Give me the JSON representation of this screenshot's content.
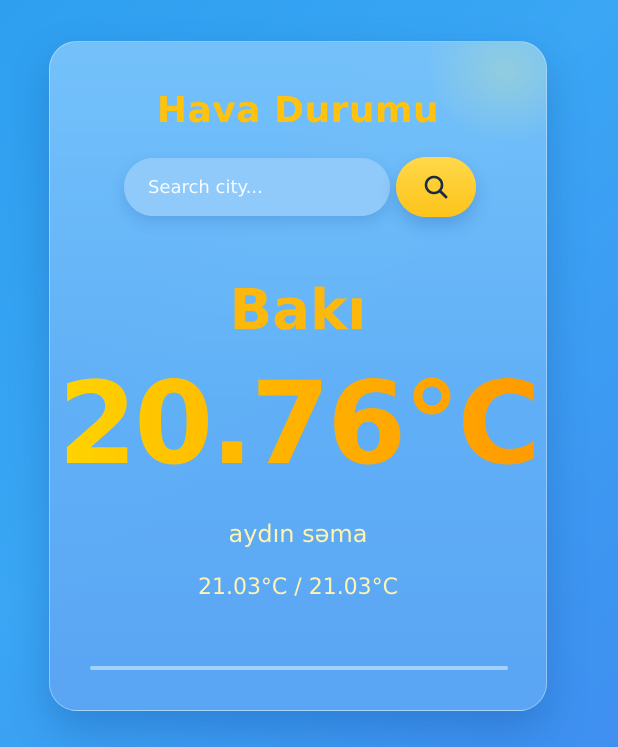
{
  "app": {
    "title": "Hava Durumu"
  },
  "search": {
    "placeholder": "Search city...",
    "value": "",
    "button_icon": "search-icon"
  },
  "weather": {
    "city": "Bakı",
    "temperature": "20.76°C",
    "condition": "aydın səma",
    "min_max": "21.03°C / 21.03°C"
  },
  "colors": {
    "background": "#3aa6f4",
    "accent_yellow": "#ffc20e",
    "accent_orange": "#ff9a00",
    "text_light": "#fff3b0"
  }
}
